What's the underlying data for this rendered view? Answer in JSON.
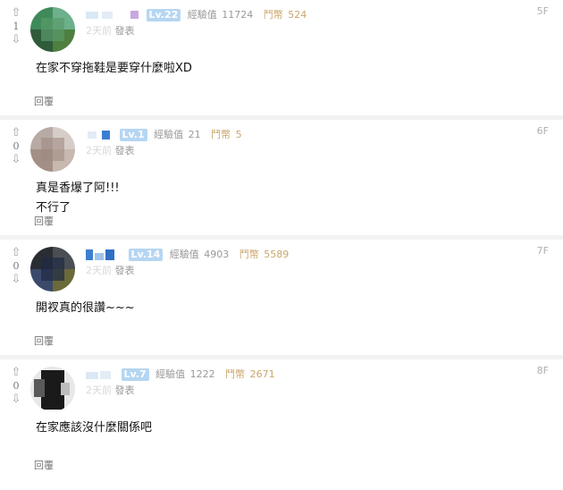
{
  "comments": [
    {
      "votes": "1",
      "level": "Lv.22",
      "exp_label": "經驗值",
      "exp": "11724",
      "coin_label": "鬥幣",
      "coins": "524",
      "time_prefix": "2天前",
      "time_suffix": "發表",
      "floor": "5F",
      "lines": [
        "在家不穿拖鞋是要穿什麼啦XD"
      ],
      "reply": "回覆"
    },
    {
      "votes": "0",
      "level": "Lv.1",
      "exp_label": "經驗值",
      "exp": "21",
      "coin_label": "鬥幣",
      "coins": "5",
      "time_prefix": "2天前",
      "time_suffix": "發表",
      "floor": "6F",
      "lines": [
        "真是香爆了阿!!!",
        "不行了"
      ],
      "reply": "回覆"
    },
    {
      "votes": "0",
      "level": "Lv.14",
      "exp_label": "經驗值",
      "exp": "4903",
      "coin_label": "鬥幣",
      "coins": "5589",
      "time_prefix": "2天前",
      "time_suffix": "發表",
      "floor": "7F",
      "lines": [
        "開衩真的很讚~~~"
      ],
      "reply": "回覆"
    },
    {
      "votes": "0",
      "level": "Lv.7",
      "exp_label": "經驗值",
      "exp": "1222",
      "coin_label": "鬥幣",
      "coins": "2671",
      "time_prefix": "2天前",
      "time_suffix": "發表",
      "floor": "8F",
      "lines": [
        "在家應該沒什麼關係吧"
      ],
      "reply": "回覆"
    }
  ],
  "icons": {
    "upvote": "up-arrow-icon",
    "downvote": "down-arrow-icon"
  },
  "colors": {
    "level_badge": "#b5d6f2",
    "coin": "#c9a56a",
    "muted": "#999999"
  }
}
